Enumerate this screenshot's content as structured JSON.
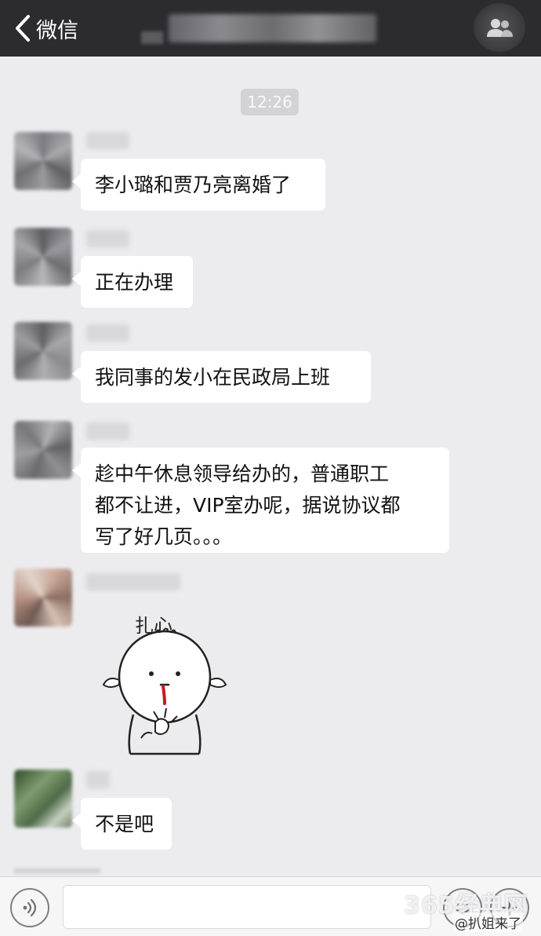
{
  "navbar": {
    "back_label": "微信",
    "back_icon": "chevron-left-icon",
    "group_icon": "group-members-icon"
  },
  "timestamp": "12:26",
  "messages": [
    {
      "type": "text",
      "text": "李小璐和贾乃亮离婚了"
    },
    {
      "type": "text",
      "text": "正在办理"
    },
    {
      "type": "text",
      "text": "我同事的发小在民政局上班"
    },
    {
      "type": "text",
      "lines": [
        "趁中午休息领导给办的，普通职工",
        "都不让进，VIP室办呢，据说协议都",
        "写了好几页。。。"
      ]
    },
    {
      "type": "sticker",
      "caption": "扎心"
    },
    {
      "type": "text",
      "text": "不是吧"
    }
  ],
  "input_bar": {
    "voice_icon": "voice-icon",
    "emoji_icon": "emoji-icon",
    "plus_icon": "plus-icon"
  },
  "watermark": {
    "site": "365经典网",
    "weibo": "@扒姐来了"
  },
  "colors": {
    "navbar": "#2c2c30",
    "chat_background": "#ececef",
    "bubble": "#ffffff"
  }
}
